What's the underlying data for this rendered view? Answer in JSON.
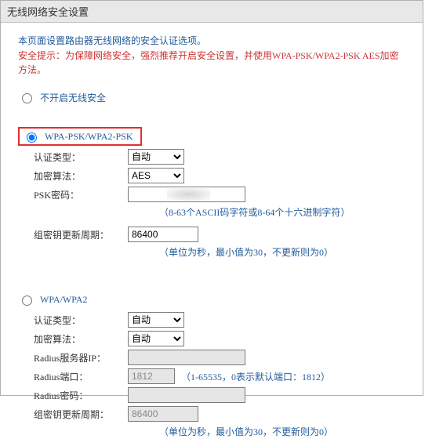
{
  "window": {
    "title": "无线网络安全设置"
  },
  "intro": "本页面设置路由器无线网络的安全认证选项。",
  "warn": "安全提示：为保障网络安全，强烈推荐开启安全设置，并使用WPA-PSK/WPA2-PSK AES加密方法。",
  "radios": {
    "none": "不开启无线安全",
    "psk": "WPA-PSK/WPA2-PSK",
    "wpa": "WPA/WPA2"
  },
  "labels": {
    "auth": "认证类型：",
    "algo": "加密算法：",
    "psk_pw": "PSK密码：",
    "rekey": "组密钥更新周期：",
    "radius_ip": "Radius服务器IP：",
    "radius_port": "Radius端口：",
    "radius_pw": "Radius密码："
  },
  "options": {
    "auto": "自动",
    "aes": "AES"
  },
  "values": {
    "psk_pw": "",
    "psk_rekey": "86400",
    "radius_ip": "",
    "radius_port": "1812",
    "radius_pw": "",
    "wpa_rekey": "86400"
  },
  "hints": {
    "psk_pw": "（8-63个ASCII码字符或8-64个十六进制字符）",
    "rekey": "（单位为秒，最小值为30，不更新则为0）",
    "radius_port": "（1-65535，0表示默认端口：1812）"
  }
}
